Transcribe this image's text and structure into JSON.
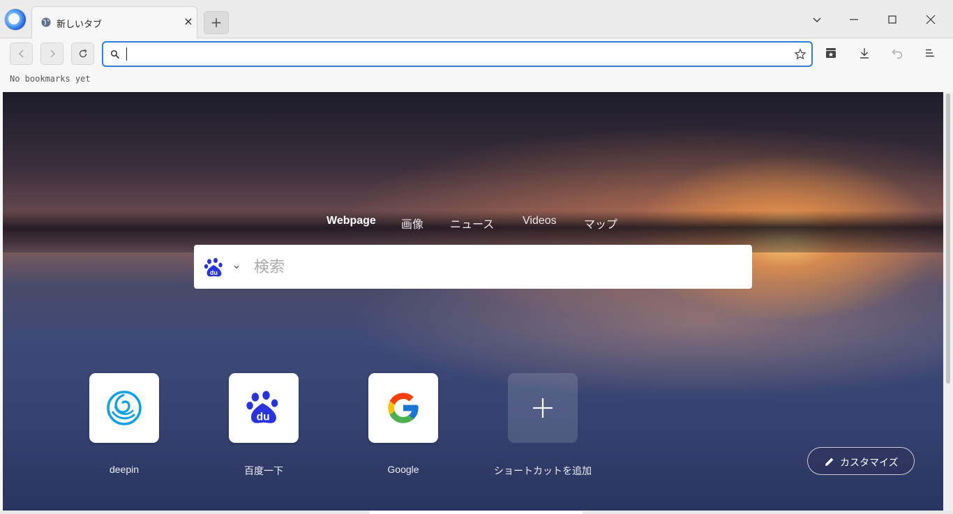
{
  "tab": {
    "title": "新しいタブ",
    "favicon": "globe-icon",
    "close": "×"
  },
  "window_controls": [
    "chevron-down-icon",
    "minimize-icon",
    "maximize-icon",
    "close-icon"
  ],
  "toolbar": {
    "address_value": "",
    "address_placeholder": "",
    "accent_color": "#2f7fd8"
  },
  "bookmarks": {
    "empty_text": "No bookmarks yet"
  },
  "search": {
    "engine_tabs": [
      {
        "label": "Webpage",
        "active": true
      },
      {
        "label": "画像",
        "active": false
      },
      {
        "label": "ニュース",
        "active": false
      },
      {
        "label": "Videos",
        "active": false
      },
      {
        "label": "マップ",
        "active": false
      }
    ],
    "engine_icon": "baidu-paw-icon",
    "placeholder": "検索"
  },
  "shortcuts": [
    {
      "label": "deepin",
      "icon": "deepin-logo-icon"
    },
    {
      "label": "百度一下",
      "icon": "baidu-paw-icon"
    },
    {
      "label": "Google",
      "icon": "google-g-icon"
    },
    {
      "label": "ショートカットを追加",
      "icon": "plus-icon"
    }
  ],
  "customize": {
    "label": "カスタマイズ",
    "icon": "pencil-icon"
  }
}
